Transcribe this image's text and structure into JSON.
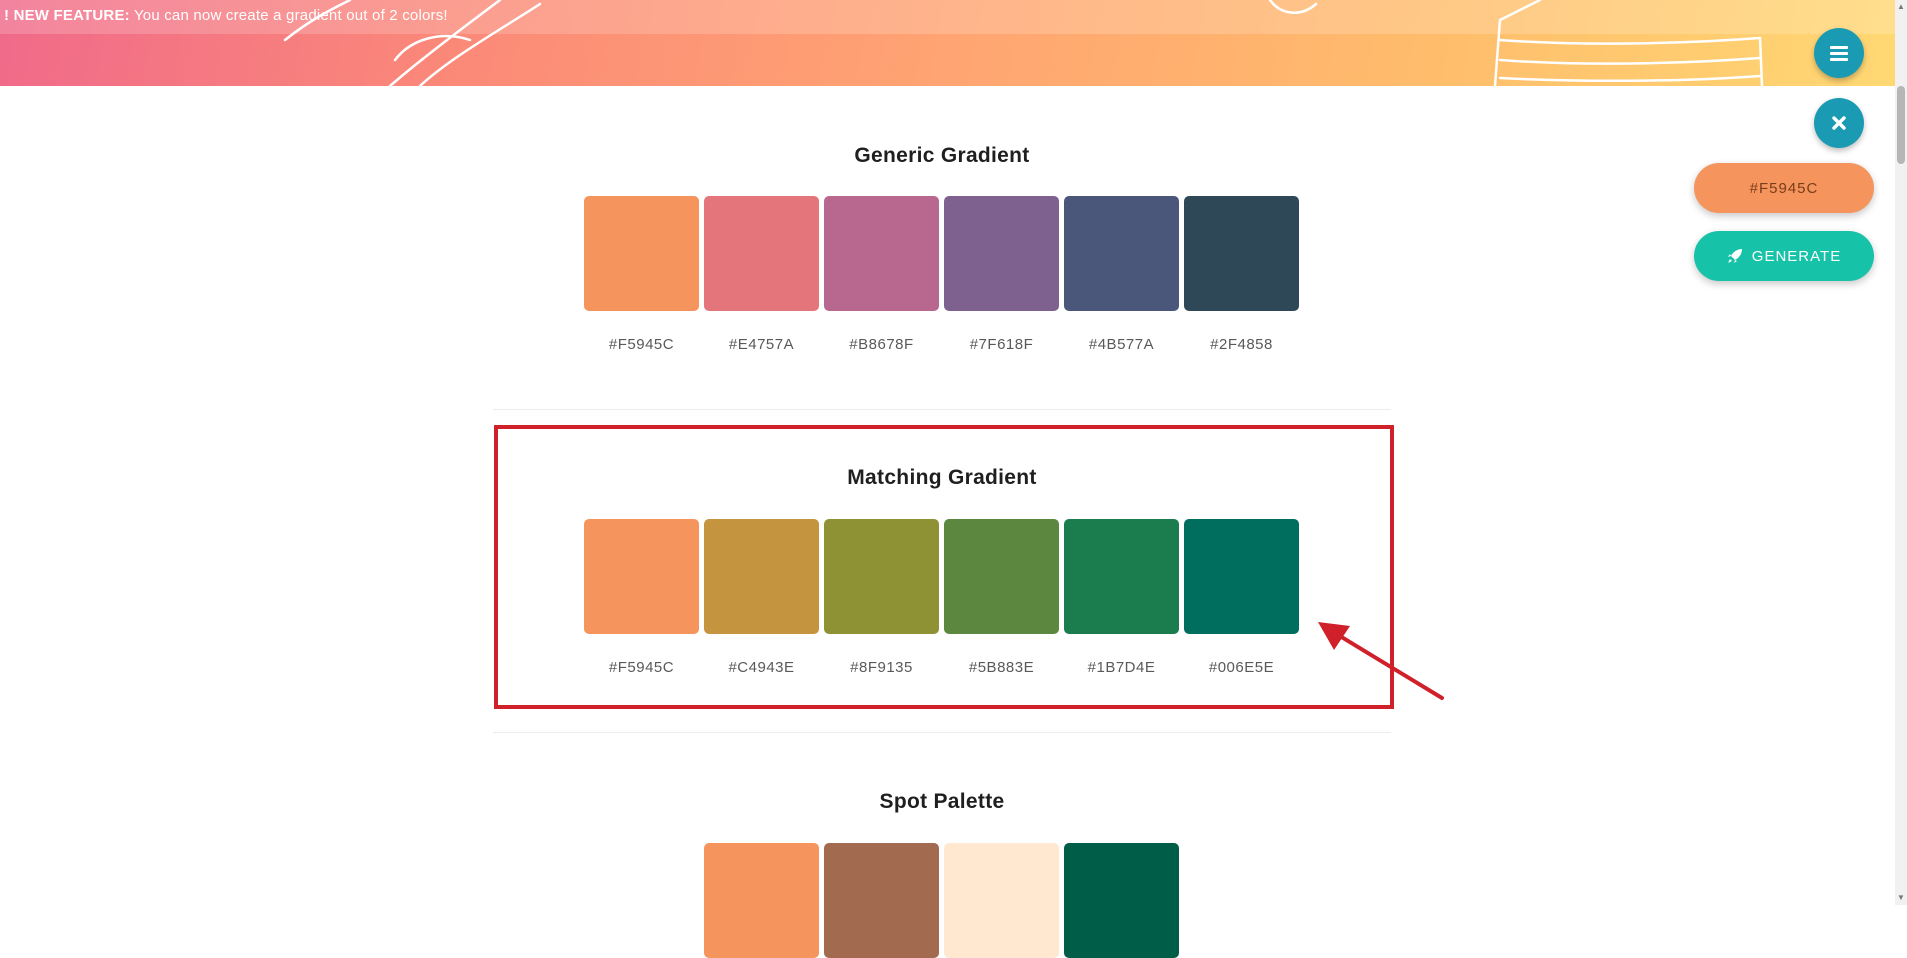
{
  "announcement": {
    "label": "! NEW FEATURE:",
    "text": "You can now create a gradient out of 2 colors!"
  },
  "fab": {
    "menu_icon": "bars-icon",
    "close_icon": "times-icon"
  },
  "actions": {
    "color_value": "#F5945C",
    "color_bg": "#F5945C",
    "generate_label": "GENERATE",
    "generate_icon": "rocket-icon"
  },
  "sections": [
    {
      "title": "Generic Gradient",
      "swatches": [
        {
          "hex": "#F5945C",
          "color": "#F5945C"
        },
        {
          "hex": "#E4757A",
          "color": "#E4757A"
        },
        {
          "hex": "#B8678F",
          "color": "#B8678F"
        },
        {
          "hex": "#7F618F",
          "color": "#7F618F"
        },
        {
          "hex": "#4B577A",
          "color": "#4B577A"
        },
        {
          "hex": "#2F4858",
          "color": "#2F4858"
        }
      ]
    },
    {
      "title": "Matching Gradient",
      "swatches": [
        {
          "hex": "#F5945C",
          "color": "#F5945C"
        },
        {
          "hex": "#C4943E",
          "color": "#C4943E"
        },
        {
          "hex": "#8F9135",
          "color": "#8F9135"
        },
        {
          "hex": "#5B883E",
          "color": "#5B883E"
        },
        {
          "hex": "#1B7D4E",
          "color": "#1B7D4E"
        },
        {
          "hex": "#006E5E",
          "color": "#006E5E"
        }
      ]
    },
    {
      "title": "Spot Palette",
      "swatches": [
        {
          "color": "#F5945C"
        },
        {
          "color": "#A26B50"
        },
        {
          "color": "#FFE7D0"
        },
        {
          "color": "#005D48"
        }
      ]
    }
  ],
  "highlight_color": "#D0202A"
}
